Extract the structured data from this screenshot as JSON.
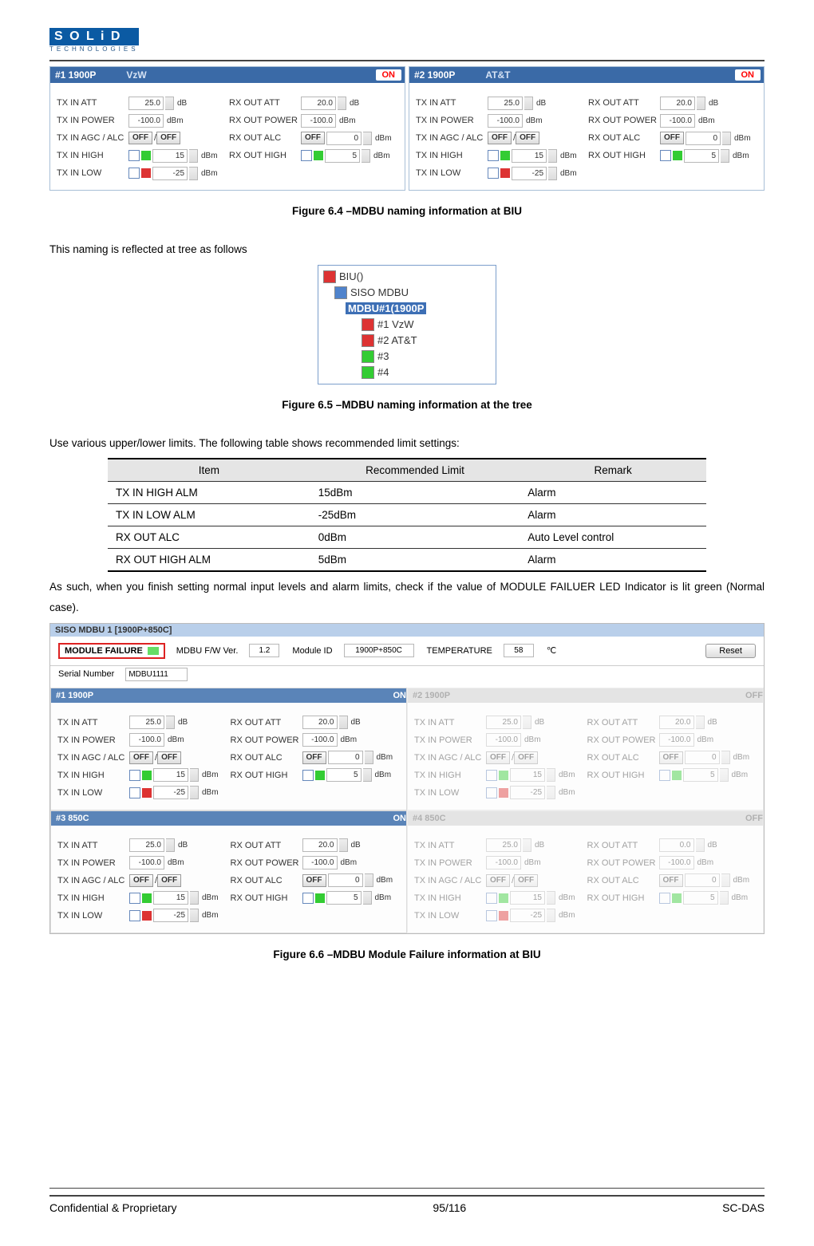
{
  "logo": {
    "top": "S O L i D",
    "sub": "TECHNOLOGIES"
  },
  "top_panels": [
    {
      "tag": "#1 1900P",
      "carrier": "VzW",
      "status": "ON",
      "tx": {
        "inatt": "25.0",
        "inpower": "-100.0",
        "agc1": "OFF",
        "agc2": "OFF",
        "inhigh": "15",
        "inlow": "-25"
      },
      "rx": {
        "outatt": "20.0",
        "outpower": "-100.0",
        "alc": "OFF",
        "alcval": "0",
        "outhigh": "5"
      }
    },
    {
      "tag": "#2 1900P",
      "carrier": "AT&T",
      "status": "ON",
      "tx": {
        "inatt": "25.0",
        "inpower": "-100.0",
        "agc1": "OFF",
        "agc2": "OFF",
        "inhigh": "15",
        "inlow": "-25"
      },
      "rx": {
        "outatt": "20.0",
        "outpower": "-100.0",
        "alc": "OFF",
        "alcval": "0",
        "outhigh": "5"
      }
    }
  ],
  "labels": {
    "tx_in_att": "TX IN ATT",
    "tx_in_power": "TX IN POWER",
    "tx_in_agc": "TX IN AGC / ALC",
    "tx_in_high": "TX IN HIGH",
    "tx_in_low": "TX IN LOW",
    "rx_out_att": "RX OUT ATT",
    "rx_out_power": "RX OUT POWER",
    "rx_out_alc": "RX OUT ALC",
    "rx_out_high": "RX OUT HIGH",
    "slash": "/",
    "db": "dB",
    "dbm": "dBm"
  },
  "captions": {
    "f64": "Figure 6.4 –MDBU naming information at BIU",
    "f65": "Figure 6.5 –MDBU naming information at the tree",
    "f66": "Figure 6.6 –MDBU Module Failure information at BIU"
  },
  "text": {
    "p1": "This naming is reflected at tree as follows",
    "p2": "Use various upper/lower limits. The following table shows recommended limit settings:",
    "p3": "As such, when you finish setting normal input levels and alarm limits, check if the value of MODULE FAILUER LED Indicator is lit green (Normal case)."
  },
  "tree": {
    "root": "BIU()",
    "siso": "SISO MDBU",
    "mdbu": "MDBU#1(1900P",
    "items": [
      "#1 VzW",
      "#2 AT&T",
      "#3",
      "#4"
    ],
    "colors": [
      "r",
      "r",
      "g",
      "g"
    ]
  },
  "table": {
    "headers": [
      "Item",
      "Recommended Limit",
      "Remark"
    ],
    "rows": [
      [
        "TX IN HIGH ALM",
        "15dBm",
        "Alarm"
      ],
      [
        "TX IN LOW ALM",
        "-25dBm",
        "Alarm"
      ],
      [
        "RX OUT ALC",
        "0dBm",
        "Auto Level control"
      ],
      [
        "RX OUT HIGH ALM",
        "5dBm",
        "Alarm"
      ]
    ]
  },
  "fig66": {
    "title": "SISO MDBU 1 [1900P+850C]",
    "module_failure": "MODULE FAILURE",
    "fw_lbl": "MDBU F/W Ver.",
    "fw": "1.2",
    "modid_lbl": "Module ID",
    "modid": "1900P+850C",
    "temp_lbl": "TEMPERATURE",
    "temp": "58",
    "temp_u": "℃",
    "reset": "Reset",
    "serial_lbl": "Serial Number",
    "serial": "MDBU1111",
    "cells": [
      {
        "tag": "#1 1900P",
        "status": "ON",
        "disabled": false,
        "tx": {
          "inatt": "25.0",
          "inpower": "-100.0",
          "agc1": "OFF",
          "agc2": "OFF",
          "inhigh": "15",
          "inlow": "-25"
        },
        "rx": {
          "outatt": "20.0",
          "outpower": "-100.0",
          "alc": "OFF",
          "alcval": "0",
          "outhigh": "5"
        }
      },
      {
        "tag": "#2 1900P",
        "status": "OFF",
        "disabled": true,
        "tx": {
          "inatt": "25.0",
          "inpower": "-100.0",
          "agc1": "OFF",
          "agc2": "OFF",
          "inhigh": "15",
          "inlow": "-25"
        },
        "rx": {
          "outatt": "20.0",
          "outpower": "-100.0",
          "alc": "OFF",
          "alcval": "0",
          "outhigh": "5"
        }
      },
      {
        "tag": "#3 850C",
        "status": "ON",
        "disabled": false,
        "tx": {
          "inatt": "25.0",
          "inpower": "-100.0",
          "agc1": "OFF",
          "agc2": "OFF",
          "inhigh": "15",
          "inlow": "-25"
        },
        "rx": {
          "outatt": "20.0",
          "outpower": "-100.0",
          "alc": "OFF",
          "alcval": "0",
          "outhigh": "5"
        }
      },
      {
        "tag": "#4 850C",
        "status": "OFF",
        "disabled": true,
        "tx": {
          "inatt": "25.0",
          "inpower": "-100.0",
          "agc1": "OFF",
          "agc2": "OFF",
          "inhigh": "15",
          "inlow": "-25"
        },
        "rx": {
          "outatt": "0.0",
          "outpower": "-100.0",
          "alc": "OFF",
          "alcval": "0",
          "outhigh": "5"
        }
      }
    ]
  },
  "footer": {
    "left": "Confidential & Proprietary",
    "center": "95/116",
    "right": "SC-DAS"
  }
}
